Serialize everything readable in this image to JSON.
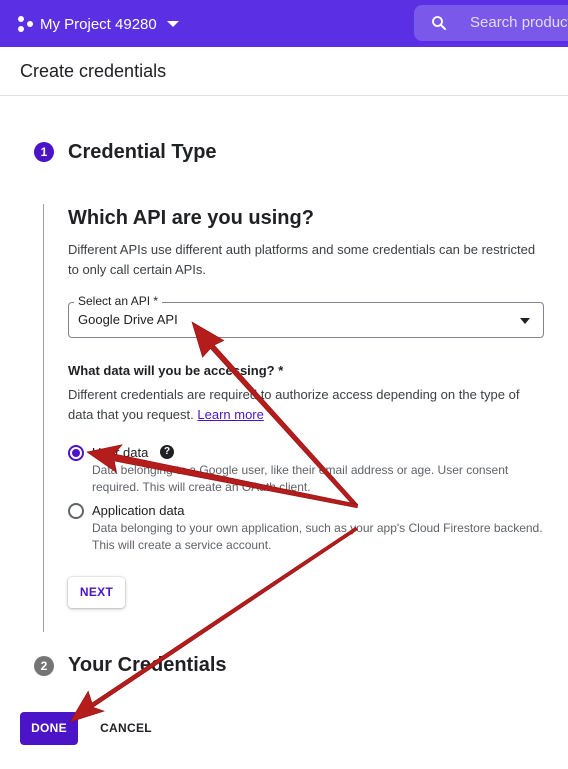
{
  "topbar": {
    "project_name": "My Project 49280",
    "search_placeholder": "Search products"
  },
  "page": {
    "title": "Create credentials"
  },
  "step1": {
    "number": "1",
    "title": "Credential Type",
    "api_heading": "Which API are you using?",
    "api_description": "Different APIs use different auth platforms and some credentials can be restricted to only call certain APIs.",
    "select_label": "Select an API *",
    "select_value": "Google Drive API",
    "question": "What data will you be accessing? *",
    "question_description": "Different credentials are required to authorize access depending on the type of data that you request.",
    "learn_more": "Learn more",
    "options": [
      {
        "label": "User data",
        "description": "Data belonging to a Google user, like their email address or age. User consent required. This will create an OAuth client.",
        "selected": true
      },
      {
        "label": "Application data",
        "description": "Data belonging to your own application, such as your app's Cloud Firestore backend. This will create a service account.",
        "selected": false
      }
    ],
    "help_symbol": "?",
    "next_label": "NEXT"
  },
  "step2": {
    "number": "2",
    "title": "Your Credentials"
  },
  "actions": {
    "done_label": "DONE",
    "cancel_label": "CANCEL"
  },
  "colors": {
    "topbar": "#5b2fe3",
    "accent": "#4b14c9",
    "annotation_arrow": "#b51c1c"
  },
  "icons": {
    "project": "project-dots-icon",
    "dropdown": "chevron-down-icon",
    "search": "search-icon",
    "help": "help-icon"
  }
}
